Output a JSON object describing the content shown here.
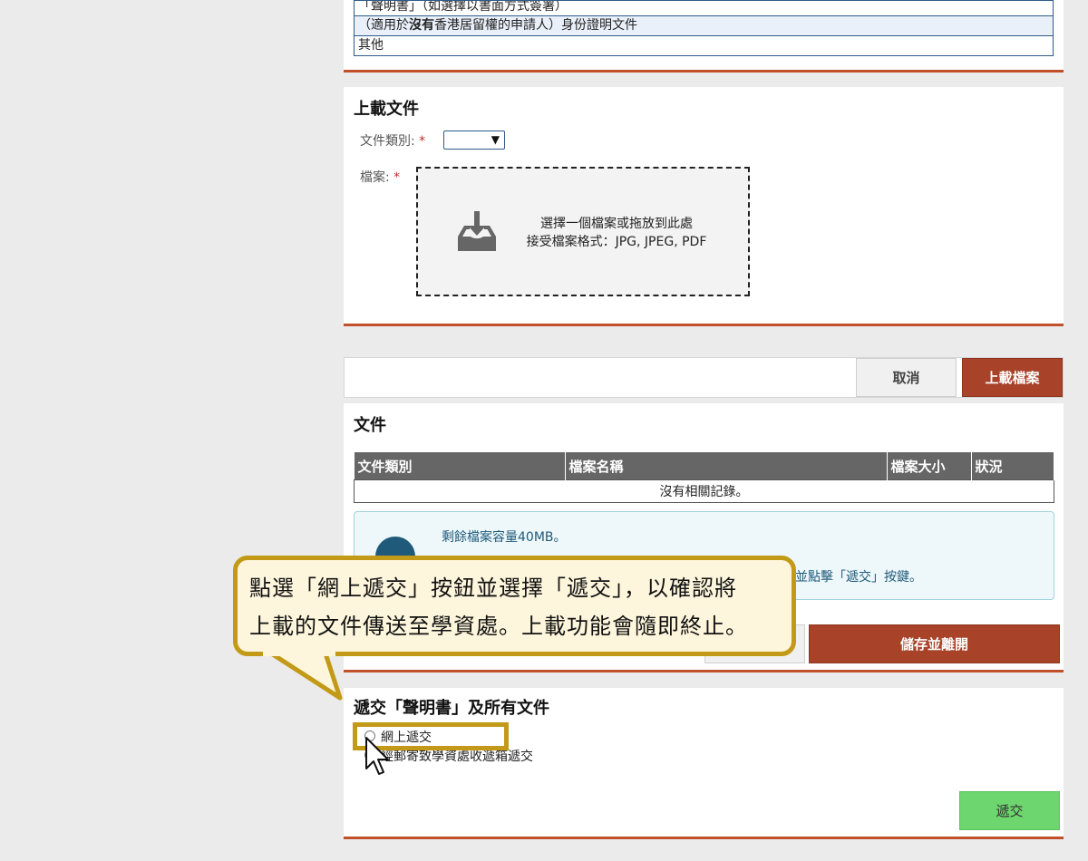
{
  "top_options": {
    "row1": "「聲明書」（如選擇以書面方式簽署）",
    "row2_pre": "（適用於",
    "row2_bold": "沒有",
    "row2_post": "香港居留權的申請人）身份證明文件",
    "row3": "其他"
  },
  "upload": {
    "title": "上載文件",
    "doc_type_label": "文件類別:",
    "file_label": "檔案:",
    "required_mark": "*",
    "dropzone_line1": "選擇一個檔案或拖放到此處",
    "dropzone_line2": "接受檔案格式：JPG, JPEG, PDF",
    "doc_type_selected": ""
  },
  "actions": {
    "cancel": "取消",
    "upload": "上載檔案"
  },
  "documents": {
    "title": "文件",
    "columns": [
      "文件類別",
      "檔案名稱",
      "檔案大小",
      "狀況"
    ],
    "empty_text": "沒有相關記錄。",
    "info_line1": "剩餘檔案容量40MB。",
    "info_line2_tail": "並點擊「遞交」按鍵。",
    "save_exit": "儲存並離開"
  },
  "submit": {
    "title": "遞交「聲明書」及所有文件",
    "option_online": "網上遞交",
    "option_mail": "經郵寄致學資處收遞箱遞交",
    "submit_button": "遞交"
  },
  "callout": {
    "line1": "點選「網上遞交」按鈕並選擇「遞交」，以確認將",
    "line2": "上載的文件傳送至學資處。上載功能會隨即終止。"
  },
  "colors": {
    "accent_red": "#a8432a",
    "callout_border": "#c29a17",
    "submit_green": "#6ed66e"
  }
}
